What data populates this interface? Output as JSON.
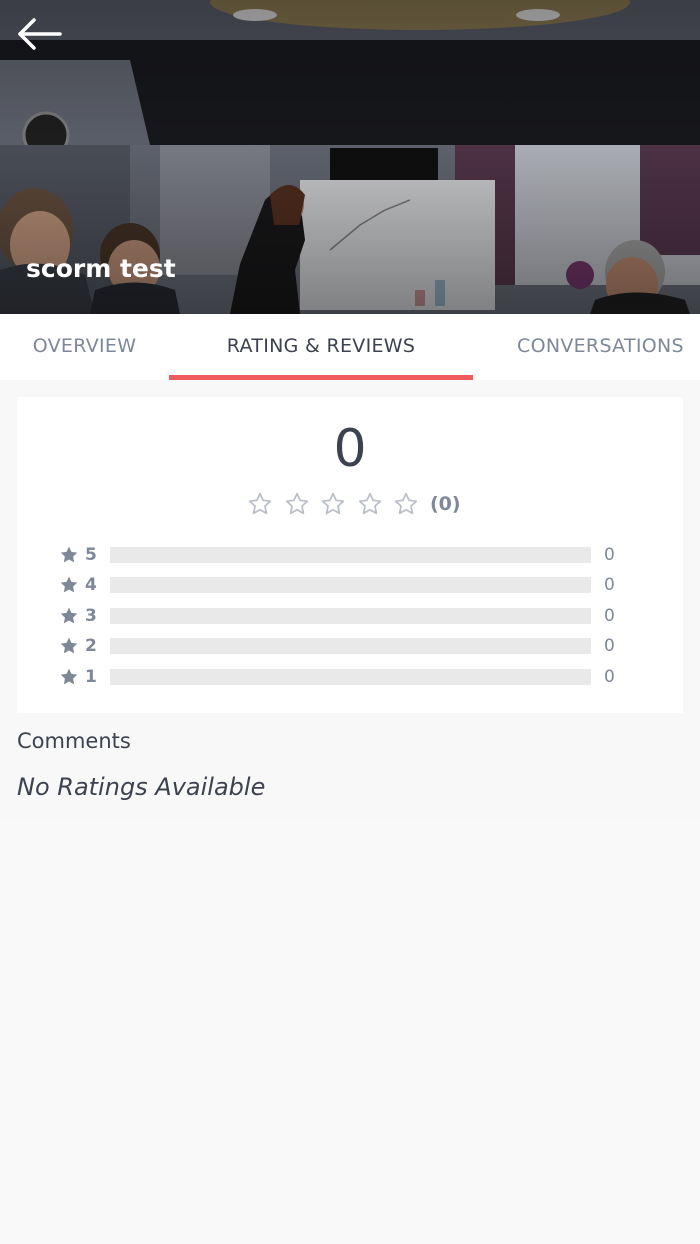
{
  "hero": {
    "title": "scorm test",
    "back_icon": "arrow-left-icon"
  },
  "tabs": [
    {
      "label": "OVERVIEW",
      "active": false
    },
    {
      "label": "RATING & REVIEWS",
      "active": true
    },
    {
      "label": "CONVERSATIONS",
      "active": false
    }
  ],
  "rating": {
    "average": "0",
    "stars_filled": 0,
    "stars_total": 5,
    "count_label": "(0)",
    "breakdown": [
      {
        "stars": "5",
        "count": "0",
        "fraction": 0
      },
      {
        "stars": "4",
        "count": "0",
        "fraction": 0
      },
      {
        "stars": "3",
        "count": "0",
        "fraction": 0
      },
      {
        "stars": "2",
        "count": "0",
        "fraction": 0
      },
      {
        "stars": "1",
        "count": "0",
        "fraction": 0
      }
    ]
  },
  "comments": {
    "title": "Comments",
    "empty_text": "No Ratings Available"
  },
  "colors": {
    "accent": "#ef5b5b",
    "text_dark": "#3d4250",
    "text_muted": "#7e8898",
    "bar_track": "#e9e9e9"
  }
}
